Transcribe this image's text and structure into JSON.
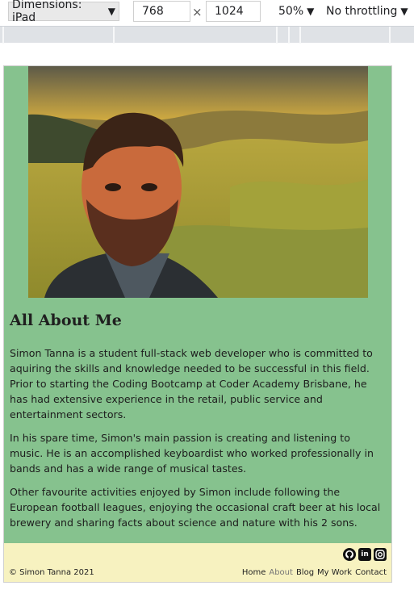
{
  "toolbar": {
    "dimensions_label": "Dimensions: iPad",
    "width": "768",
    "times": "×",
    "height": "1024",
    "zoom": "50%",
    "throttling": "No throttling",
    "caret": "▼"
  },
  "page": {
    "heading": "All About Me",
    "paragraphs": [
      "Simon Tanna is a student full-stack web developer who is committed to aquiring the skills and knowledge needed to be successful in this field. Prior to starting the Coding Bootcamp at Coder Academy Brisbane, he has had extensive experience in the retail, public service and entertainment sectors.",
      "In his spare time, Simon's main passion is creating and listening to music. He is an accomplished keyboardist who worked professionally in bands and has a wide range of musical tastes.",
      "Other favourite activities enjoyed by Simon include following the European football leagues, enjoying the occasional craft beer at his local brewery and sharing facts about science and nature with his 2 sons."
    ]
  },
  "footer": {
    "copyright": "© Simon Tanna 2021",
    "nav": [
      {
        "label": "Home",
        "active": false
      },
      {
        "label": "About",
        "active": true
      },
      {
        "label": "Blog",
        "active": false
      },
      {
        "label": "My Work",
        "active": false
      },
      {
        "label": "Contact",
        "active": false
      }
    ],
    "social_icons": [
      "github-icon",
      "linkedin-icon",
      "instagram-icon"
    ]
  },
  "colors": {
    "page_background": "#86c28e",
    "footer_background": "#f7f2c0",
    "active_link": "#777777"
  }
}
